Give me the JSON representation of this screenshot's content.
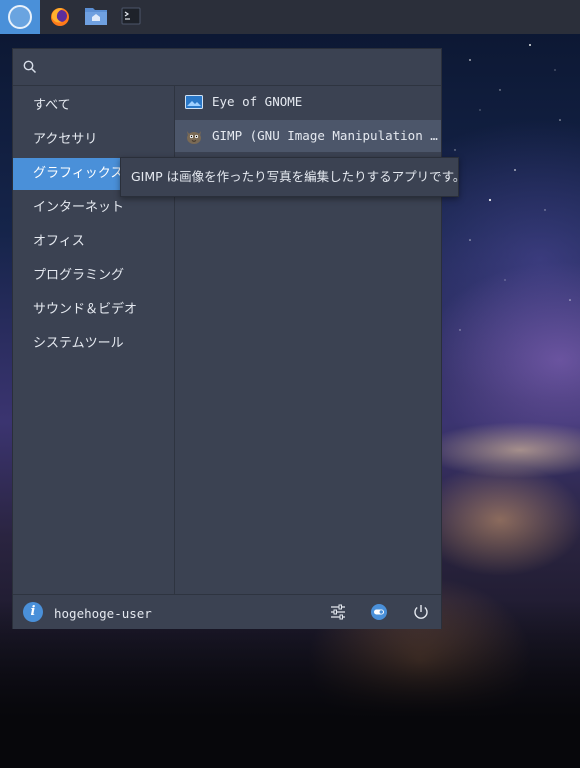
{
  "search": {
    "placeholder": "",
    "value": ""
  },
  "categories": [
    {
      "label": "すべて"
    },
    {
      "label": "アクセサリ"
    },
    {
      "label": "グラフィックス"
    },
    {
      "label": "インターネット"
    },
    {
      "label": "オフィス"
    },
    {
      "label": "プログラミング"
    },
    {
      "label": "サウンド＆ビデオ"
    },
    {
      "label": "システムツール"
    }
  ],
  "active_category": "グラフィックス",
  "apps": [
    {
      "label": "Eye of GNOME",
      "icon": "image-viewer-icon"
    },
    {
      "label": "GIMP (GNU Image Manipulation …",
      "icon": "gimp-icon"
    }
  ],
  "tooltip": {
    "text": "GIMP は画像を作ったり写真を編集したりするアプリです。"
  },
  "user": {
    "name": "hogehoge-user"
  },
  "colors": {
    "accent": "#4a90d9",
    "panel": "#3b4252",
    "taskbar": "#2b2f3a"
  }
}
